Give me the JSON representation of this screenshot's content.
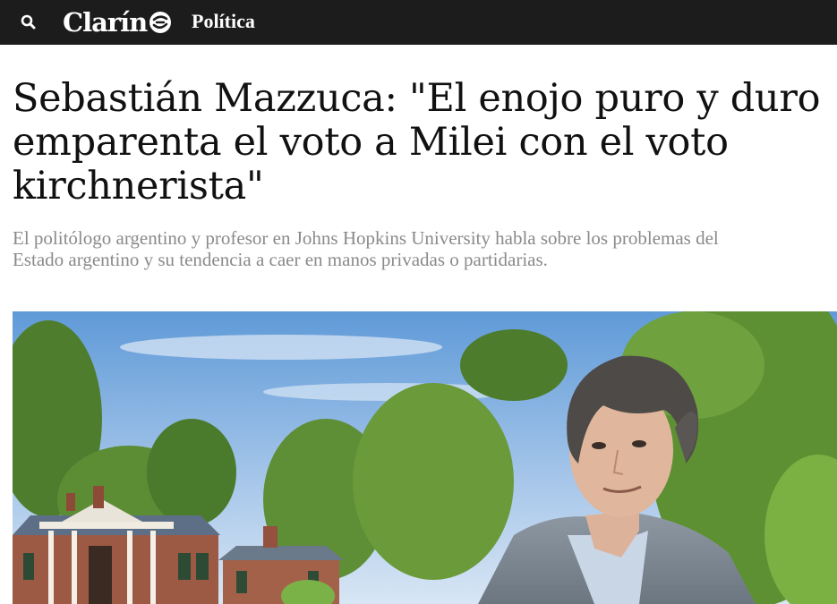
{
  "header": {
    "logo_text": "Clarín",
    "section_label": "Política"
  },
  "article": {
    "headline": "Sebastián Mazzuca: \"El enojo puro y duro emparenta el voto a Milei con el voto kirchnerista\"",
    "subhead_line1": "El politólogo argentino y profesor en Johns Hopkins University habla sobre los problemas del",
    "subhead_line2": "Estado argentino y su tendencia a caer en manos privadas o partidarias."
  },
  "colors": {
    "topbar": "#1c1c1c",
    "headline": "#111111",
    "subhead": "#8a8a8a"
  },
  "icons": {
    "search": "search-icon",
    "logo_mark": "clarin-logo-mark"
  }
}
